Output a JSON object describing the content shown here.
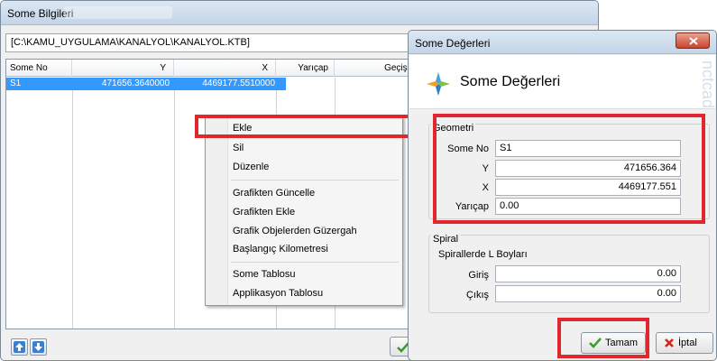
{
  "main_window": {
    "title": "Some Bilgileri",
    "path": "[C:\\KAMU_UYGULAMA\\KANALYOL\\KANALYOL.KTB]",
    "columns": [
      "Some No",
      "Y",
      "X",
      "Yarıçap",
      "Geçiş L"
    ],
    "rows": [
      {
        "some_no": "S1",
        "y": "471656.3640000",
        "x": "4469177.5510000"
      }
    ]
  },
  "context_menu": {
    "items": [
      {
        "label": "Ekle"
      },
      {
        "label": "Sil"
      },
      {
        "label": "Düzenle"
      },
      {
        "label": "Grafikten Güncelle"
      },
      {
        "label": "Grafikten Ekle"
      },
      {
        "label": "Grafik Objelerden Güzergah"
      },
      {
        "label": "Başlangıç Kilometresi"
      },
      {
        "label": "Some Tablosu"
      },
      {
        "label": "Applikasyon Tablosu"
      }
    ]
  },
  "dialog": {
    "title": "Some Değerleri",
    "header_title": "Some Değerleri",
    "watermark": "nctcad",
    "geometry": {
      "group_title": "Geometri",
      "some_no_label": "Some No",
      "some_no_value": "S1",
      "y_label": "Y",
      "y_value": "471656.364",
      "x_label": "X",
      "x_value": "4469177.551",
      "radius_label": "Yarıçap",
      "radius_value": "0.00"
    },
    "spiral": {
      "group_title": "Spiral",
      "subtitle": "Spirallerde L Boyları",
      "giris_label": "Giriş",
      "giris_value": "0.00",
      "cikis_label": "Çıkış",
      "cikis_value": "0.00"
    },
    "ok_label": "Tamam",
    "cancel_label": "İptal"
  },
  "colors": {
    "highlight_red": "#e1262e",
    "selection_blue": "#3399ff"
  }
}
